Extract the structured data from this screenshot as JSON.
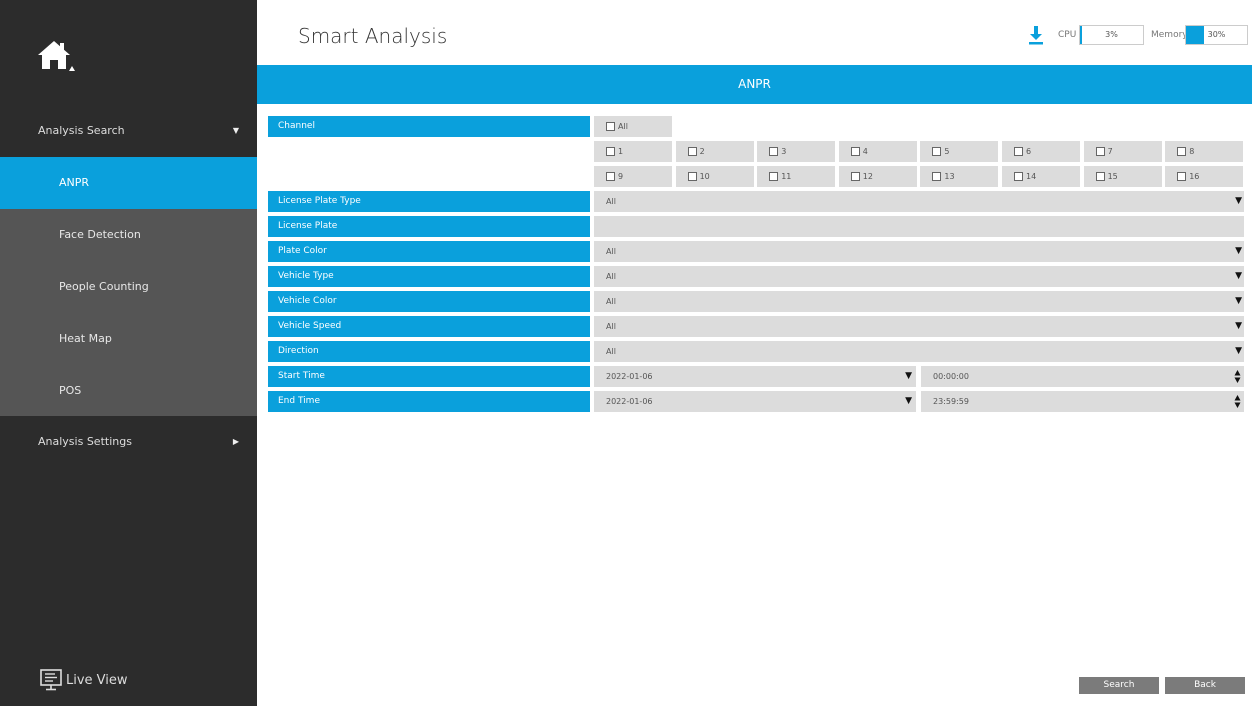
{
  "header": {
    "title": "Smart Analysis",
    "cpu_label": "CPU",
    "cpu_value": "3%",
    "cpu_fraction": 0.03,
    "memory_label": "Memory",
    "memory_value": "30%",
    "memory_fraction": 0.3
  },
  "banner": {
    "title": "ANPR"
  },
  "sidebar": {
    "group1": "Analysis Search",
    "items": [
      "ANPR",
      "Face Detection",
      "People Counting",
      "Heat Map",
      "POS"
    ],
    "group2": "Analysis Settings",
    "live_view": "Live View"
  },
  "form": {
    "channel_label": "Channel",
    "all_label": "All",
    "channels": [
      "1",
      "2",
      "3",
      "4",
      "5",
      "6",
      "7",
      "8",
      "9",
      "10",
      "11",
      "12",
      "13",
      "14",
      "15",
      "16"
    ],
    "plate_type_label": "License Plate Type",
    "plate_type_value": "All",
    "plate_label": "License Plate",
    "plate_value": "",
    "plate_color_label": "Plate Color",
    "plate_color_value": "All",
    "vehicle_type_label": "Vehicle Type",
    "vehicle_type_value": "All",
    "vehicle_color_label": "Vehicle Color",
    "vehicle_color_value": "All",
    "vehicle_speed_label": "Vehicle Speed",
    "vehicle_speed_value": "All",
    "direction_label": "Direction",
    "direction_value": "All",
    "start_label": "Start Time",
    "start_date": "2022-01-06",
    "start_time": "00:00:00",
    "end_label": "End Time",
    "end_date": "2022-01-06",
    "end_time": "23:59:59"
  },
  "buttons": {
    "search": "Search",
    "back": "Back"
  },
  "colors": {
    "accent": "#0aa0dc",
    "sidebar_bg": "#2c2c2c",
    "submenu_bg": "#555555",
    "field_bg": "#dcdcdc",
    "button_bg": "#7b7b7b"
  }
}
